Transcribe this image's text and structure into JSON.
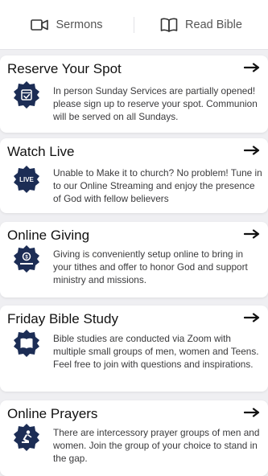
{
  "top_tabs": [
    {
      "label": "Sermons",
      "icon": "video-camera-icon"
    },
    {
      "label": "Read Bible",
      "icon": "open-book-icon"
    }
  ],
  "cards": [
    {
      "title": "Reserve Your Spot",
      "icon": "calendar-check-icon",
      "body": "In person Sunday Services are partially opened! please sign up to reserve your spot. Communion will be served on all Sundays."
    },
    {
      "title": "Watch Live",
      "icon": "live-badge-icon",
      "badge_text": "LIVE",
      "body": "Unable to Make it to church? No problem! Tune in to our Online Streaming and enjoy the presence of God with fellow believers"
    },
    {
      "title": "Online Giving",
      "icon": "money-giving-icon",
      "body": "Giving is conveniently setup online to bring in your tithes and offer to honor God and support ministry and missions."
    },
    {
      "title": "Friday Bible Study",
      "icon": "bible-book-icon",
      "body": "Bible studies are conducted via Zoom with multiple small groups of men, women and Teens. Feel free to join with questions and inspirations."
    },
    {
      "title": "Online Prayers",
      "icon": "praying-person-icon",
      "body": "There are intercessory prayer groups of men and women. Join the group of your choice to stand in the gap."
    }
  ],
  "colors": {
    "badge": "#1c2d55",
    "arrow": "#111111"
  }
}
